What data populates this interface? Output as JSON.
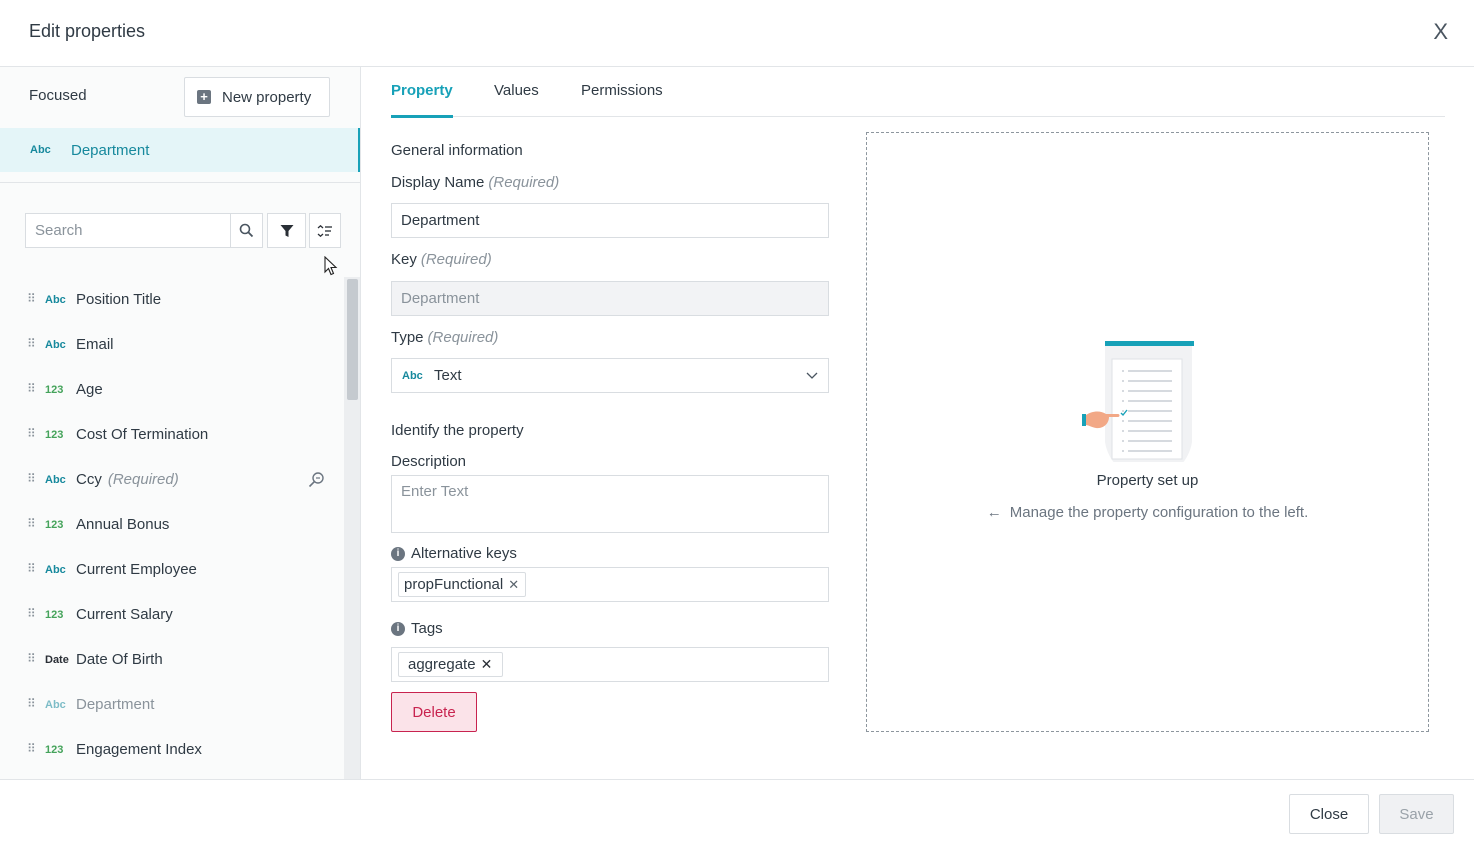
{
  "header": {
    "title": "Edit properties",
    "close_glyph": "X"
  },
  "sidebar": {
    "focused_label": "Focused",
    "new_property_label": "New property",
    "focused_item": {
      "type": "Abc",
      "label": "Department"
    },
    "search_placeholder": "Search",
    "items": [
      {
        "type": "Abc",
        "label": "Position Title"
      },
      {
        "type": "Abc",
        "label": "Email"
      },
      {
        "type": "123",
        "label": "Age"
      },
      {
        "type": "123",
        "label": "Cost Of Termination"
      },
      {
        "type": "Abc",
        "label": "Ccy",
        "required": "(Required)"
      },
      {
        "type": "123",
        "label": "Annual Bonus"
      },
      {
        "type": "Abc",
        "label": "Current Employee"
      },
      {
        "type": "123",
        "label": "Current Salary"
      },
      {
        "type": "Date",
        "label": "Date Of Birth"
      },
      {
        "type": "Abc",
        "label": "Department"
      },
      {
        "type": "123",
        "label": "Engagement Index"
      }
    ]
  },
  "tabs": [
    "Property",
    "Values",
    "Permissions"
  ],
  "form": {
    "general_title": "General information",
    "display_name_label": "Display Name",
    "display_name_required": "(Required)",
    "display_name_value": "Department",
    "key_label": "Key",
    "key_required": "(Required)",
    "key_value": "Department",
    "type_label": "Type",
    "type_required": "(Required)",
    "type_badge": "Abc",
    "type_value": "Text",
    "identify_title": "Identify the property",
    "description_label": "Description",
    "description_placeholder": "Enter Text",
    "alt_keys_label": "Alternative keys",
    "alt_keys": [
      "propFunctional"
    ],
    "tags_label": "Tags",
    "tags": [
      "aggregate"
    ],
    "delete_label": "Delete"
  },
  "panel": {
    "title": "Property set up",
    "description": "Manage the property configuration to the left."
  },
  "footer": {
    "close_label": "Close",
    "save_label": "Save"
  },
  "colors": {
    "accent": "#17a1b8",
    "danger": "#c8234f",
    "number_type": "#45a35b"
  }
}
